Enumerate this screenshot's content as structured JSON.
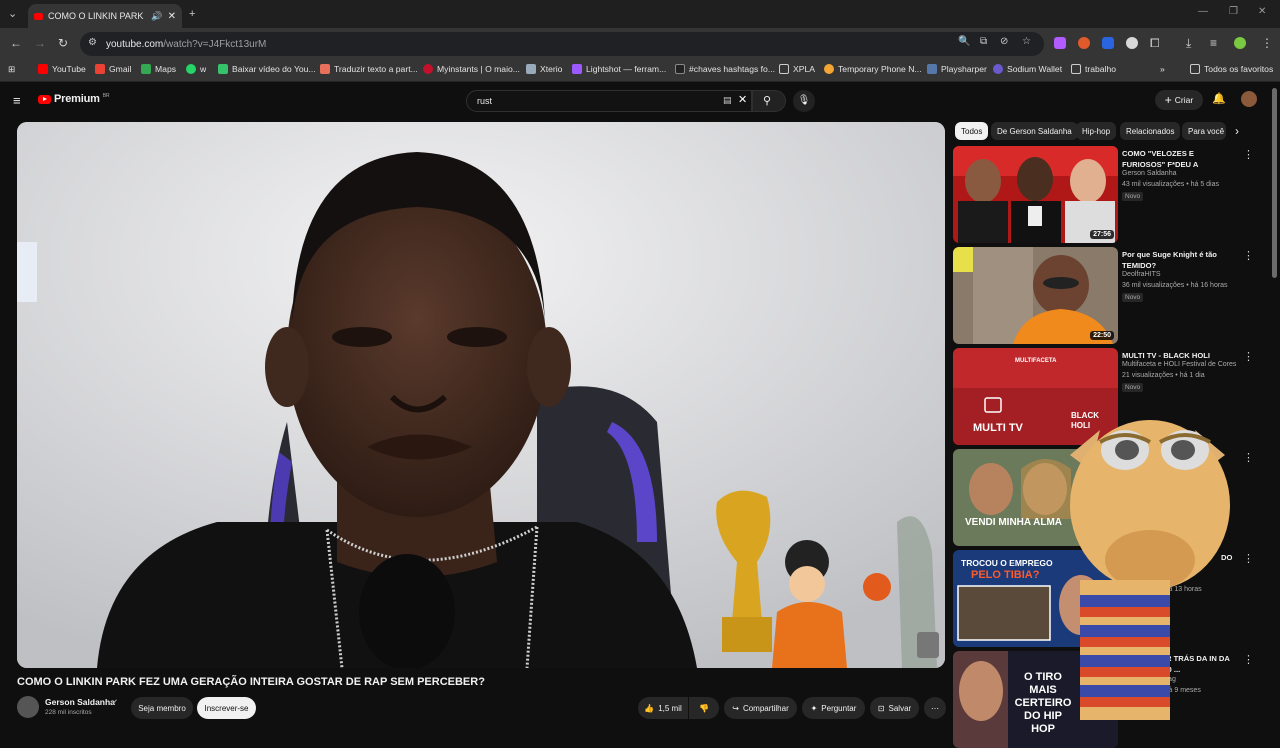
{
  "browser": {
    "tab_title": "COMO O LINKIN PARK FEZ",
    "url_host": "youtube.com",
    "url_path": "/watch?v=J4Fkct13urM",
    "bookmarks": [
      "YouTube",
      "Gmail",
      "Maps",
      "w",
      "Baixar vídeo do You...",
      "Traduzir texto a part...",
      "Myinstants | O maio...",
      "Xterio",
      "Lightshot — ferram...",
      "#chaves hashtags fo...",
      "XPLA",
      "Temporary Phone N...",
      "Playsharper",
      "Sodium Wallet",
      "trabalho"
    ],
    "all_bookmarks": "Todos os favoritos",
    "chevrons": "»"
  },
  "youtube": {
    "logo_text": "Premium",
    "logo_badge": "BR",
    "search_value": "rust",
    "create_label": "Criar"
  },
  "video": {
    "title": "COMO O LINKIN PARK FEZ UMA GERAÇÃO INTEIRA GOSTAR DE RAP SEM PERCEBER?",
    "channel": "Gerson Saldanha",
    "subscribers": "228 mil inscritos",
    "member_label": "Seja membro",
    "subscribe_label": "Inscrever-se",
    "likes": "1,5 mil",
    "share_label": "Compartilhar",
    "ask_label": "Perguntar",
    "save_label": "Salvar"
  },
  "chips": [
    "Todos",
    "De Gerson Saldanha",
    "Hip-hop",
    "Relacionados",
    "Para você"
  ],
  "recommendations": [
    {
      "title": "COMO \"VELOZES E FURIOSOS\" F*DEU A CARREIRA DE CANTOR ...",
      "channel": "Gerson Saldanha",
      "meta": "43 mil visualizações • há 5 dias",
      "badge": "Novo",
      "duration": "27:56"
    },
    {
      "title": "Por que Suge Knight é tão TEMIDO?",
      "channel": "DeolfraHITS",
      "meta": "36 mil visualizações • há 16 horas",
      "badge": "Novo",
      "duration": "22:50"
    },
    {
      "title": "MULTI TV - BLACK HOLI",
      "channel": "Multifaceta e HOLI Festival de Cores",
      "meta": "21 visualizações • há 1 dia",
      "badge": "Novo",
      "duration": ""
    },
    {
      "title": "",
      "channel": "",
      "meta": "",
      "badge": "",
      "duration": ""
    },
    {
      "title": "DO",
      "channel": "",
      "meta": "lizações • há 13 horas",
      "badge": "",
      "duration": ""
    },
    {
      "title": "IA REAL POR TRÁS DA IN DA CLUB\" DO 50 ...",
      "channel": "Rag",
      "meta": "lizações • há 9 meses",
      "badge": "",
      "duration": ""
    }
  ],
  "thumb_texts": {
    "multitv": "MULTI TV",
    "multifaceta": "MULTIFACETA",
    "black_holi": "BLACK HOLI",
    "vendi": "VENDI MINHA ALMA",
    "trocou": "TROCOU O EMPREGO",
    "tibia": "PELO TIBIA?",
    "tiro": "O TIRO MAIS CERTEIRO DO HIP HOP"
  },
  "colors": {
    "bg": "#0f0f0f",
    "youtube_red": "#ff0000",
    "chip": "#272727"
  }
}
